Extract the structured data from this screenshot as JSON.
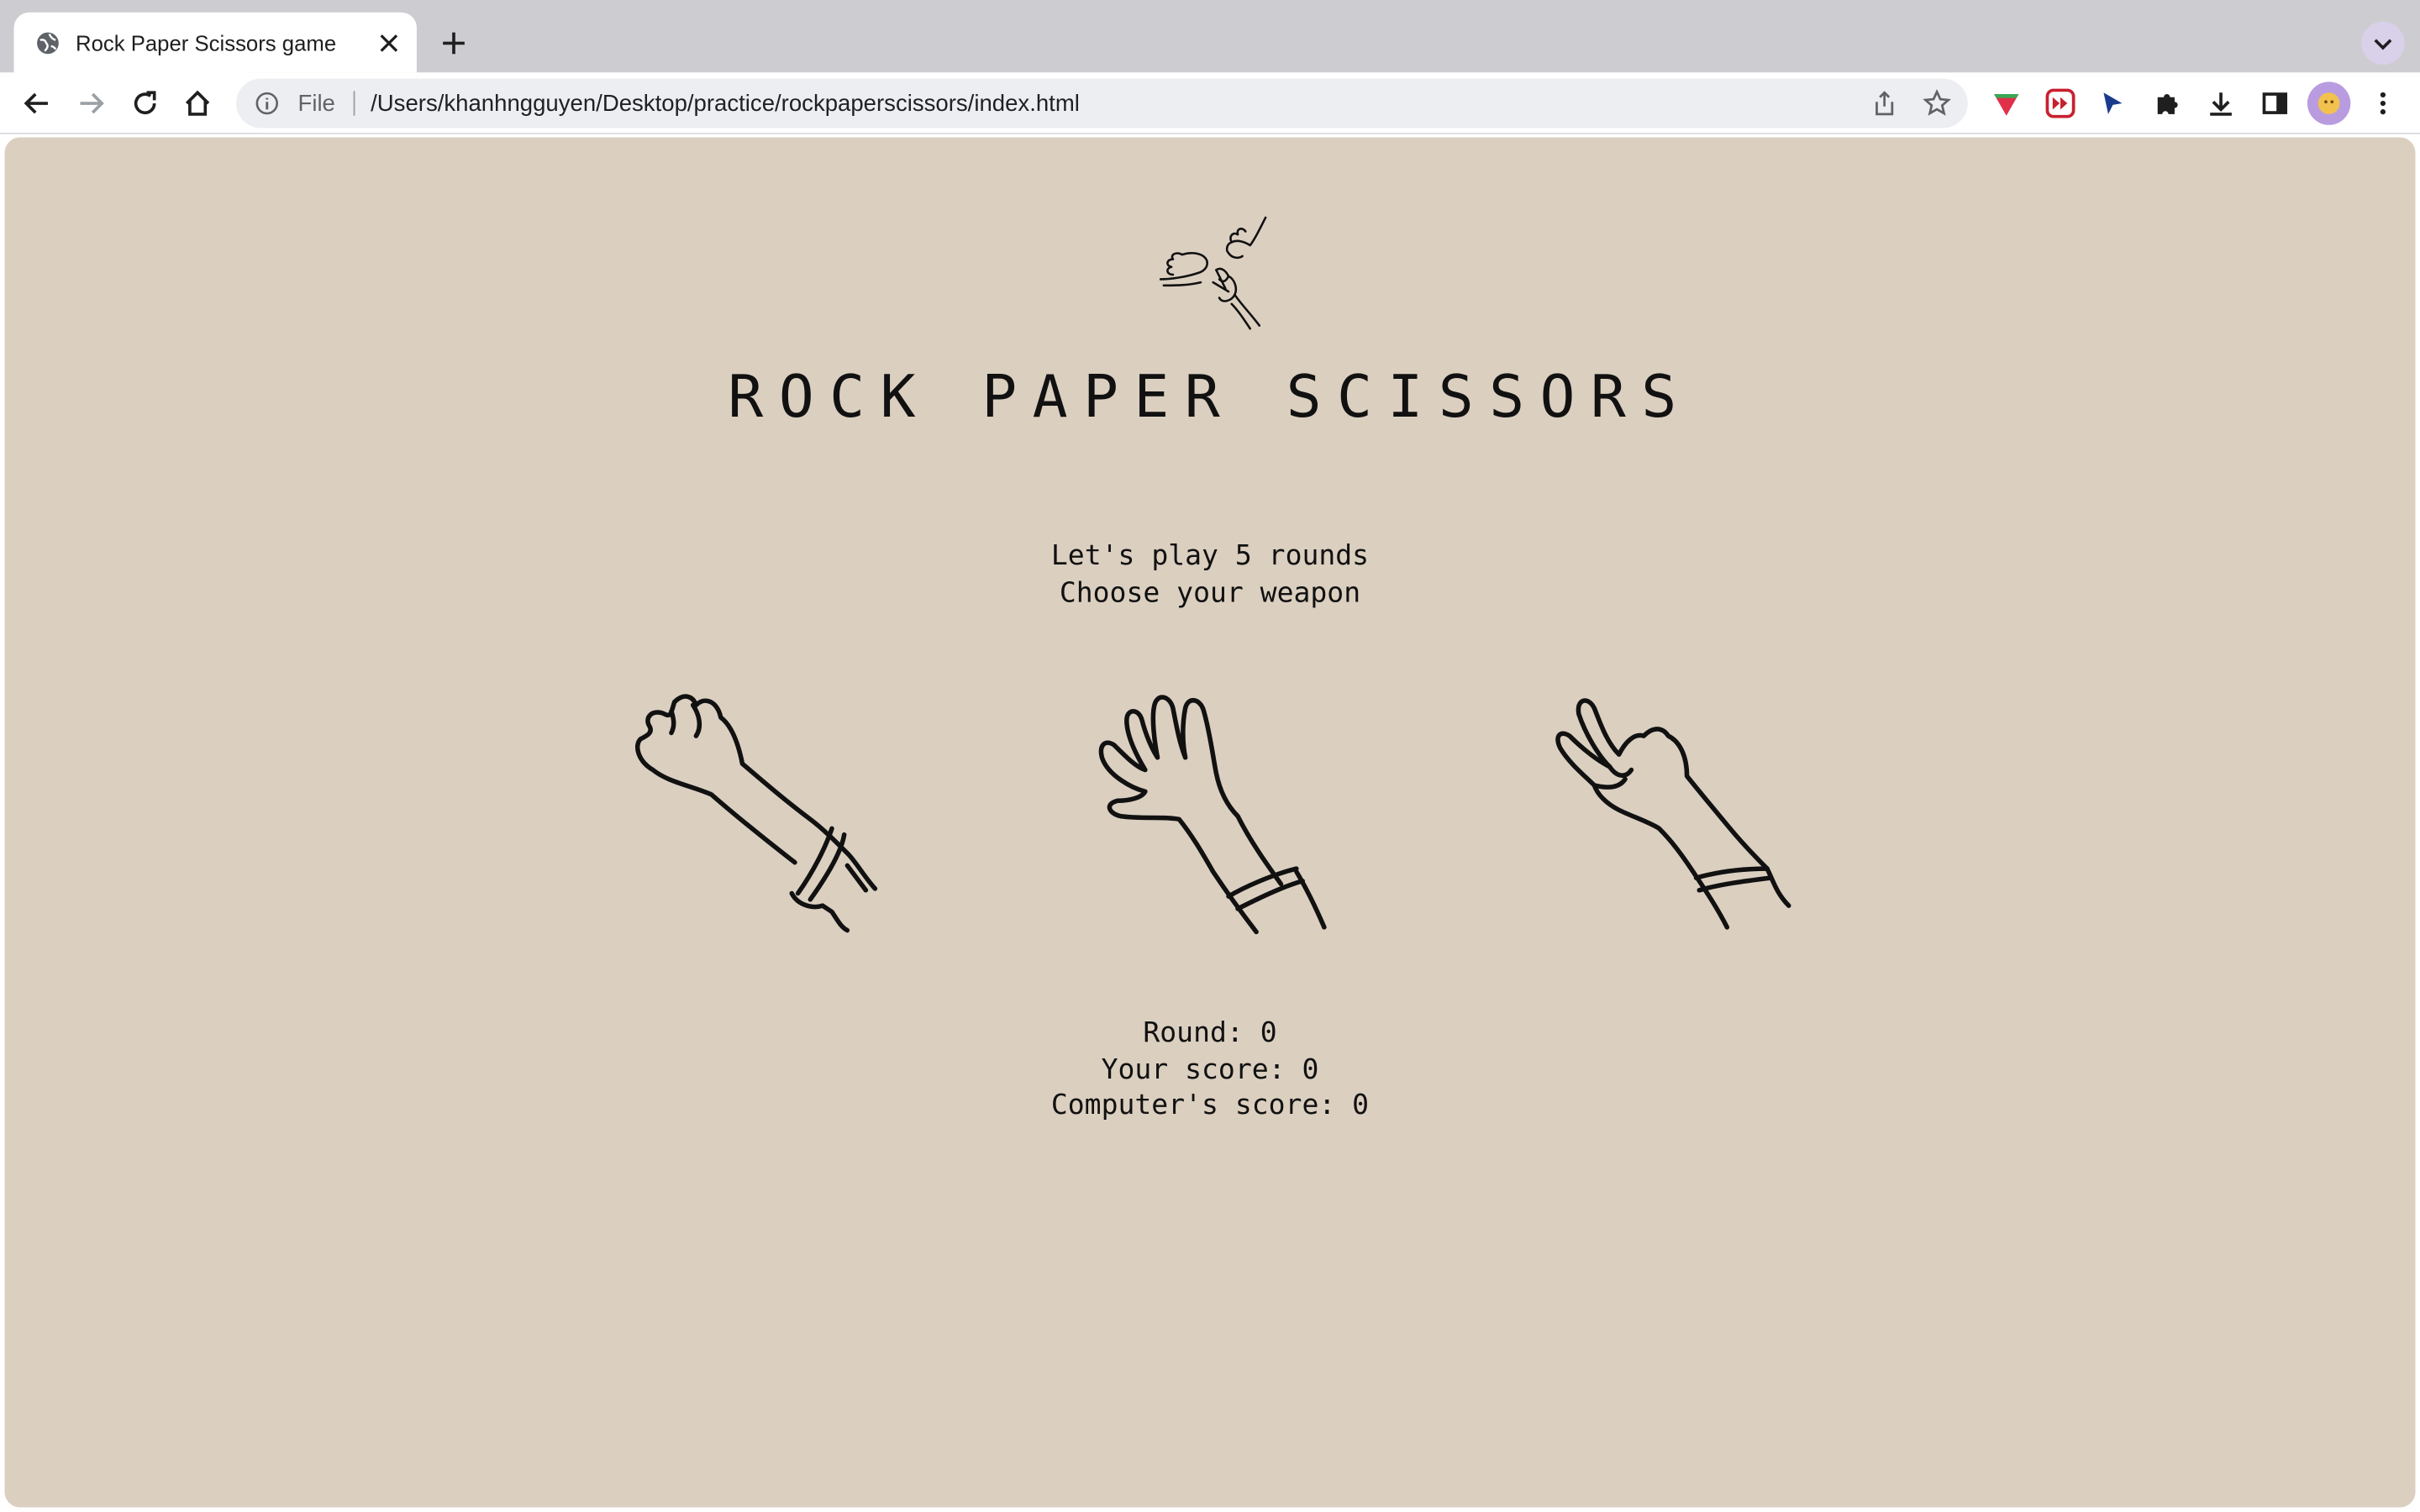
{
  "browser": {
    "tab_title": "Rock Paper Scissors game",
    "omnibox_scheme": "File",
    "url": "/Users/khanhngguyen/Desktop/practice/rockpaperscissors/index.html"
  },
  "page": {
    "title": "ROCK PAPER SCISSORS",
    "intro": [
      "Let's play 5 rounds",
      "Choose your weapon"
    ],
    "weapons": [
      {
        "name": "rock",
        "icon": "rock-hand-icon"
      },
      {
        "name": "paper",
        "icon": "paper-hand-icon"
      },
      {
        "name": "scissors",
        "icon": "scissors-hand-icon"
      }
    ],
    "round_label": "Round: ",
    "round": 0,
    "player_label": "Your score: ",
    "player_score": 0,
    "computer_label": "Computer's score: ",
    "computer_score": 0
  },
  "colors": {
    "page_background": "#dbcfc0",
    "ink": "#111111"
  }
}
